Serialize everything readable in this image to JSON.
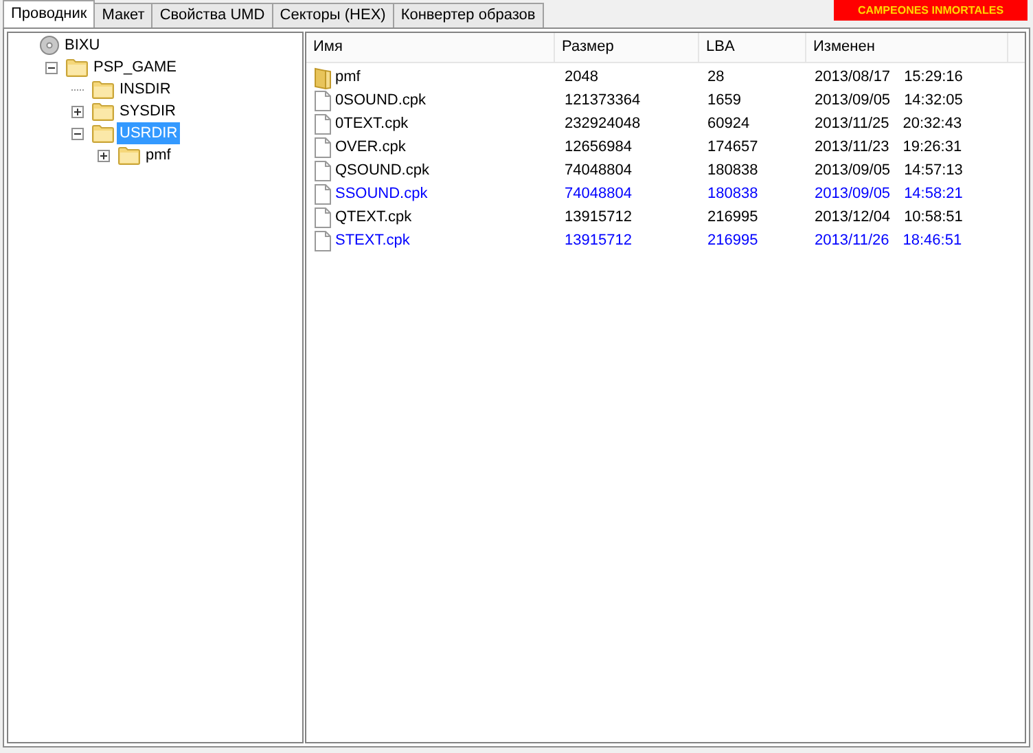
{
  "tabs": [
    {
      "label": "Проводник",
      "selected": true
    },
    {
      "label": "Макет",
      "selected": false
    },
    {
      "label": "Свойства UMD",
      "selected": false
    },
    {
      "label": "Секторы (HEX)",
      "selected": false
    },
    {
      "label": "Конвертер образов",
      "selected": false
    }
  ],
  "banner": {
    "subtitle": "CAMPEONES INMORTALES"
  },
  "tree": [
    {
      "label": "BIXU",
      "kind": "disc",
      "selected": false,
      "children": [
        {
          "label": "PSP_GAME",
          "kind": "folder",
          "expanded": true,
          "selected": false,
          "children": [
            {
              "label": "INSDIR",
              "kind": "folder",
              "selected": false
            },
            {
              "label": "SYSDIR",
              "kind": "folder",
              "expanded": false,
              "selected": false
            },
            {
              "label": "USRDIR",
              "kind": "folder",
              "expanded": true,
              "selected": true,
              "children": [
                {
                  "label": "pmf",
                  "kind": "folder",
                  "expanded": false,
                  "selected": false
                }
              ]
            }
          ]
        }
      ]
    }
  ],
  "table": {
    "columns": [
      "Имя",
      "Размер",
      "LBA",
      "Изменен"
    ],
    "rows": [
      {
        "kind": "folder",
        "name": "pmf",
        "size": "2048",
        "lba": "28",
        "date": "2013/08/17",
        "time": "15:29:16",
        "modified": false
      },
      {
        "kind": "file",
        "name": "0SOUND.cpk",
        "size": "121373364",
        "lba": "1659",
        "date": "2013/09/05",
        "time": "14:32:05",
        "modified": false
      },
      {
        "kind": "file",
        "name": "0TEXT.cpk",
        "size": "232924048",
        "lba": "60924",
        "date": "2013/11/25",
        "time": "20:32:43",
        "modified": false
      },
      {
        "kind": "file",
        "name": "OVER.cpk",
        "size": "12656984",
        "lba": "174657",
        "date": "2013/11/23",
        "time": "19:26:31",
        "modified": false
      },
      {
        "kind": "file",
        "name": "QSOUND.cpk",
        "size": "74048804",
        "lba": "180838",
        "date": "2013/09/05",
        "time": "14:57:13",
        "modified": false
      },
      {
        "kind": "file",
        "name": "SSOUND.cpk",
        "size": "74048804",
        "lba": "180838",
        "date": "2013/09/05",
        "time": "14:58:21",
        "modified": true
      },
      {
        "kind": "file",
        "name": "QTEXT.cpk",
        "size": "13915712",
        "lba": "216995",
        "date": "2013/12/04",
        "time": "10:58:51",
        "modified": false
      },
      {
        "kind": "file",
        "name": "STEXT.cpk",
        "size": "13915712",
        "lba": "216995",
        "date": "2013/11/26",
        "time": "18:46:51",
        "modified": true
      }
    ]
  }
}
